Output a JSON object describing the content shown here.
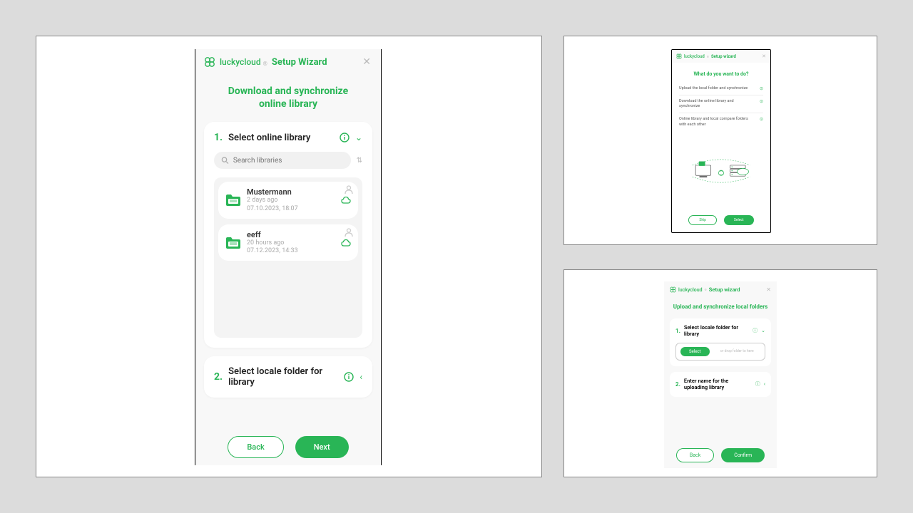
{
  "panel1": {
    "brand": "luckycloud",
    "brandSub": "®",
    "wizardTitle": "Setup Wizard",
    "subtitle": "Download and synchronize online library",
    "step1": {
      "num": "1.",
      "title": "Select online library"
    },
    "searchPlaceholder": "Search libraries",
    "libraries": [
      {
        "name": "Mustermann",
        "ago": "2 days ago",
        "ts": "07.10.2023, 18:07"
      },
      {
        "name": "eeff",
        "ago": "20 hours ago",
        "ts": "07.12.2023, 14:33"
      }
    ],
    "step2": {
      "num": "2.",
      "title": "Select locale folder for library"
    },
    "back": "Back",
    "next": "Next"
  },
  "panel2": {
    "brand": "luckycloud",
    "brandSub": "®",
    "wizardTitle": "Setup wizard",
    "subtitle": "What do you want to do?",
    "options": [
      "Upload the local folder and synchronize",
      "Download the online library and synchronize",
      "Online library and local compare folders with each other"
    ],
    "skip": "Skip",
    "select": "Select"
  },
  "panel3": {
    "brand": "luckycloud",
    "brandSub": "®",
    "wizardTitle": "Setup wizard",
    "subtitle": "Upload and synchronize local folders",
    "step1": {
      "num": "1.",
      "title": "Select locale folder for library"
    },
    "selectBtn": "Select",
    "dropHint": "or drop folder to here",
    "step2": {
      "num": "2.",
      "title": "Enter name for the uploading library"
    },
    "back": "Back",
    "confirm": "Confirm"
  }
}
